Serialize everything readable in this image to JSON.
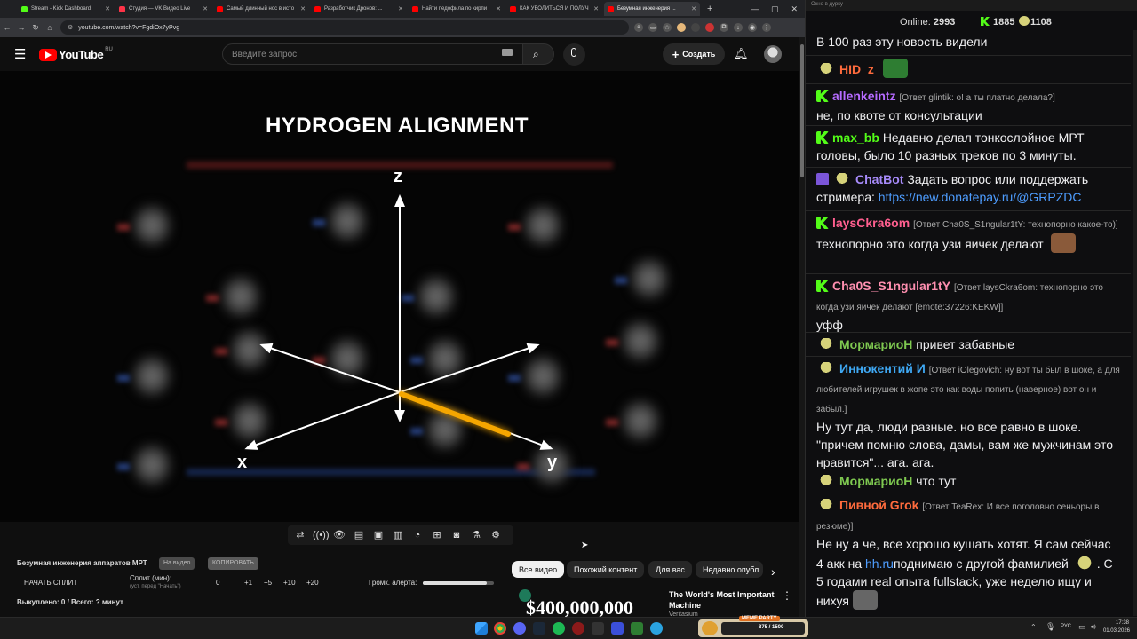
{
  "browser": {
    "tabs": [
      {
        "label": "Stream - Kick Dashboard",
        "color": "#53fc18"
      },
      {
        "label": "Студия — VK Видео Live",
        "color": "#ff3347"
      },
      {
        "label": "Самый длинный нос в исто",
        "color": "#ff0000"
      },
      {
        "label": "Разработчик Дронов: ...",
        "color": "#ff0000"
      },
      {
        "label": "Найти педофила по кирпи",
        "color": "#ff0000"
      },
      {
        "label": "КАК УВОЛИТЬСЯ И ПОЛУЧ",
        "color": "#ff0000"
      },
      {
        "label": "Безумная инженерия ...",
        "color": "#ff0000",
        "active": true
      }
    ],
    "new_tab": "+",
    "url": "youtube.com/watch?v=FgdiOx7yPvg"
  },
  "youtube": {
    "logo": "YouTube",
    "region": "RU",
    "search_placeholder": "Введите запрос",
    "create_label": "Создать",
    "video_title_overlay": "HYDROGEN ALIGNMENT",
    "axis": {
      "z": "z",
      "x": "x",
      "y": "y"
    }
  },
  "below": {
    "video_name": "Безумная инженерия аппаратов МРТ",
    "pill_video": "На видео",
    "pill_copy": "КОПИРОВАТЬ",
    "start_split": "НАЧАТЬ СПЛИТ",
    "split_label": "Сплит (мин):",
    "split_hint": "(уст. перед \"Начать\")",
    "split_values": [
      "0",
      "+1",
      "+5",
      "+10",
      "+20"
    ],
    "volume_label": "Громк. алерта:",
    "volume_level": 0.9,
    "bought": "Выкуплено: 0 / Всего: ? минут"
  },
  "chips": [
    {
      "label": "Все видео",
      "selected": true
    },
    {
      "label": "Похожий контент"
    },
    {
      "label": "Для вас"
    },
    {
      "label": "Недавно опубл"
    }
  ],
  "recommendation": {
    "thumb_text": "$400,000,000",
    "title": "The World's Most Important Machine",
    "channel": "Veritasium"
  },
  "chat": {
    "window_title": "Окно в дурку",
    "online_label": "Online:",
    "online_count": "2993",
    "kick_count": "1885",
    "yt_count": "1108",
    "messages": [
      {
        "text": "В 100 раз эту новость видели"
      },
      {
        "badge": "yt",
        "nick": "HID_z",
        "color": "#ff6b3d",
        "text": ""
      },
      {
        "badge": "kick",
        "nick": "allenkeintz",
        "color": "#b66bff",
        "reply": "[Ответ glintik: о! а ты платно делала?]",
        "text": "не, по квоте от консультации"
      },
      {
        "badge": "kick",
        "nick": "max_bb",
        "color": "#53fc18",
        "text": "Недавно делал тонкослойное МРТ головы, было 10 разных треков по 3 минуты."
      },
      {
        "badge": "bot",
        "nick": "ChatBot",
        "color": "#a78bfa",
        "text": "Задать вопрос или поддержать стримера:",
        "link": "https://new.donatepay.ru/@GRPZDC"
      },
      {
        "badge": "kick",
        "nick": "laysCkra6om",
        "color": "#ff5f8f",
        "reply": "[Ответ Cha0S_S1ngular1tY: технопорно какое-то)]",
        "text": "технопорно это когда узи яичек делают"
      },
      {
        "badge": "kick",
        "nick": "Cha0S_S1ngular1tY",
        "color": "#ff8fb0",
        "reply": "[Ответ laysCkra6om: технопорно это когда узи яичек делают [emote:37226:KEKW]]",
        "text": "уфф"
      },
      {
        "badge": "yt",
        "nick": "МормариоН",
        "color": "#7ec850",
        "text": "привет забавные"
      },
      {
        "badge": "yt",
        "nick": "Иннокентий И",
        "color": "#3fa9f5",
        "reply": "[Ответ iOlegovich: ну вот ты был в шоке, а для любителей игрушек в жопе это как воды попить (наверное) вот он и забыл.]",
        "text": "Ну тут да, люди разные. но все равно в шоке. \"причем помню слова, дамы, вам же мужчинам это нравится\"... ага. ага."
      },
      {
        "badge": "yt",
        "nick": "МормариоН",
        "color": "#7ec850",
        "text": "что тут"
      },
      {
        "badge": "yt",
        "nick": "Пивной Grok",
        "color": "#ff6b3d",
        "reply": "[Ответ TeaRex: И все поголовно сеньоры в резюме)]",
        "text": "Не ну а че, все хорошо кушать хотят. Я сам сейчас 4 акк на",
        "link2": "hh.ru",
        "text2": "поднимаю с другой фамилией",
        "text3": ". С 5 годами real опыта fullstack, уже неделю ищу и нихуя"
      }
    ]
  },
  "taskbar": {
    "overlay_label": "MEME PARTY",
    "overlay_progress": "875 / 1500",
    "lang": "РУС",
    "time": "17:38",
    "date": "01.03.2026"
  }
}
